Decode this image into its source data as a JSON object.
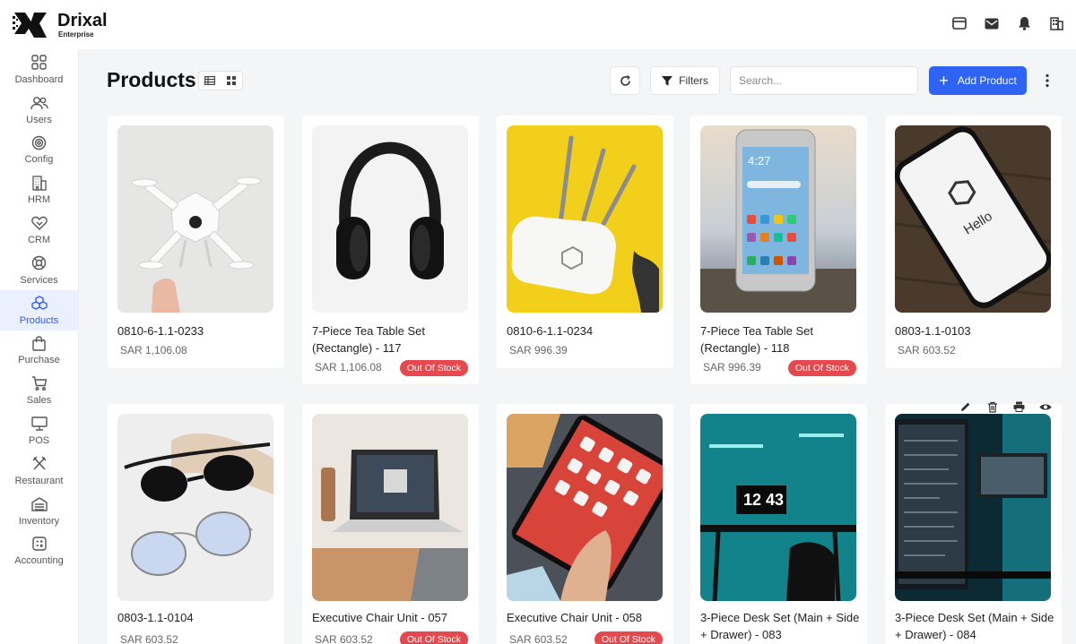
{
  "brand": {
    "name": "Drixal",
    "sub": "Enterprise"
  },
  "top_icons": [
    "browser-window-icon",
    "mail-icon",
    "bell-icon",
    "building-icon"
  ],
  "sidebar": {
    "items": [
      {
        "label": "Dashboard",
        "icon": "grid-icon"
      },
      {
        "label": "Users",
        "icon": "users-icon"
      },
      {
        "label": "Config",
        "icon": "settings-icon"
      },
      {
        "label": "HRM",
        "icon": "office-building-icon"
      },
      {
        "label": "CRM",
        "icon": "handshake-icon"
      },
      {
        "label": "Services",
        "icon": "lifebuoy-icon"
      },
      {
        "label": "Products",
        "icon": "cubes-icon",
        "active": true
      },
      {
        "label": "Purchase",
        "icon": "shopping-bag-icon"
      },
      {
        "label": "Sales",
        "icon": "cart-icon"
      },
      {
        "label": "POS",
        "icon": "monitor-icon"
      },
      {
        "label": "Restaurant",
        "icon": "utensils-icon"
      },
      {
        "label": "Inventory",
        "icon": "warehouse-icon"
      },
      {
        "label": "Accounting",
        "icon": "calculator-icon"
      }
    ]
  },
  "header": {
    "title": "Products",
    "filters_label": "Filters",
    "search_placeholder": "Search...",
    "add_label": "Add Product"
  },
  "colors": {
    "accent": "#2e63f6",
    "out_of_stock": "#e5484d",
    "active_nav_bg": "#eaf0ff"
  },
  "products": [
    {
      "name": "0810-6-1.1-0233",
      "price": "SAR 1,106.08",
      "image": "drone"
    },
    {
      "name": "7-Piece Tea Table Set (Rectangle) - 117",
      "price": "SAR 1,106.08",
      "badge": "Out Of Stock",
      "image": "headphones"
    },
    {
      "name": "0810-6-1.1-0234",
      "price": "SAR 996.39",
      "image": "router"
    },
    {
      "name": "7-Piece Tea Table Set (Rectangle) - 118",
      "price": "SAR 996.39",
      "badge": "Out Of Stock",
      "image": "smartphone"
    },
    {
      "name": "0803-1.1-0103",
      "price": "SAR 603.52",
      "image": "phone-hello"
    },
    {
      "name": "0803-1.1-0104",
      "price": "SAR 603.52",
      "image": "sunglasses"
    },
    {
      "name": "Executive Chair Unit - 057",
      "price": "SAR 603.52",
      "badge": "Out Of Stock",
      "image": "laptop"
    },
    {
      "name": "Executive Chair Unit - 058",
      "price": "SAR 603.52",
      "badge": "Out Of Stock",
      "image": "tablet"
    },
    {
      "name": "3-Piece Desk Set (Main + Side + Drawer) - 083",
      "image": "desk-clock",
      "clock_text": "12 43"
    },
    {
      "name": "3-Piece Desk Set (Main + Side + Drawer) - 084",
      "image": "desk-monitors"
    }
  ],
  "phone_screen_text": {
    "time": "4:27",
    "greeting": "Hello"
  },
  "card_actions": [
    "edit-icon",
    "trash-icon",
    "print-icon",
    "eye-icon"
  ]
}
